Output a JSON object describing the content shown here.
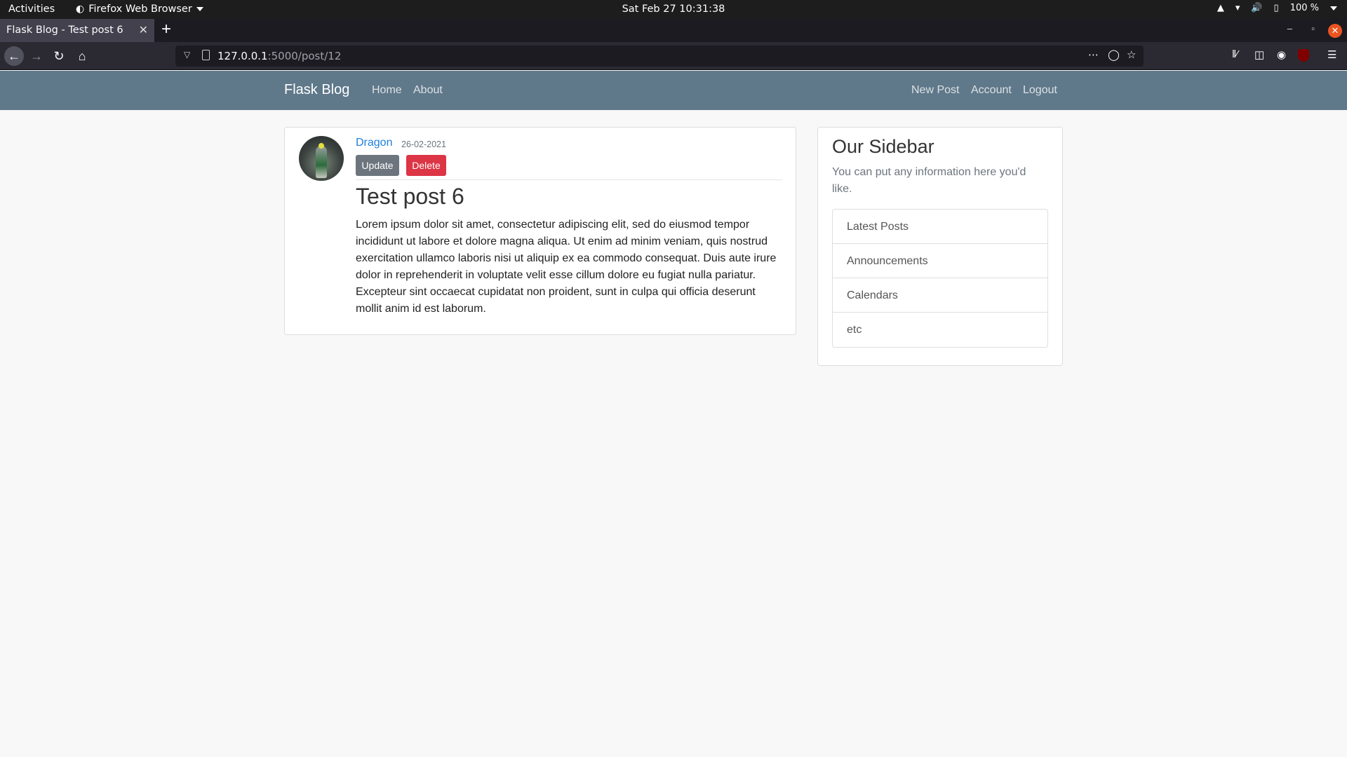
{
  "system": {
    "activities": "Activities",
    "app_name": "Firefox Web Browser",
    "clock": "Sat Feb 27  10:31:38",
    "battery": "100 %"
  },
  "browser": {
    "tab_title": "Flask Blog - Test post 6",
    "url_host": "127.0.0.1",
    "url_path": ":5000/post/12"
  },
  "site": {
    "brand": "Flask Blog",
    "nav_left": [
      "Home",
      "About"
    ],
    "nav_right": [
      "New Post",
      "Account",
      "Logout"
    ],
    "accent": "#5f788a"
  },
  "post": {
    "author": "Dragon",
    "date": "26-02-2021",
    "update_label": "Update",
    "delete_label": "Delete",
    "title": "Test post 6",
    "content": "Lorem ipsum dolor sit amet, consectetur adipiscing elit, sed do eiusmod tempor incididunt ut labore et dolore magna aliqua. Ut enim ad minim veniam, quis nostrud exercitation ullamco laboris nisi ut aliquip ex ea commodo consequat. Duis aute irure dolor in reprehenderit in voluptate velit esse cillum dolore eu fugiat nulla pariatur. Excepteur sint occaecat cupidatat non proident, sunt in culpa qui officia deserunt mollit anim id est laborum."
  },
  "sidebar": {
    "title": "Our Sidebar",
    "description": "You can put any information here you'd like.",
    "items": [
      "Latest Posts",
      "Announcements",
      "Calendars",
      "etc"
    ]
  }
}
